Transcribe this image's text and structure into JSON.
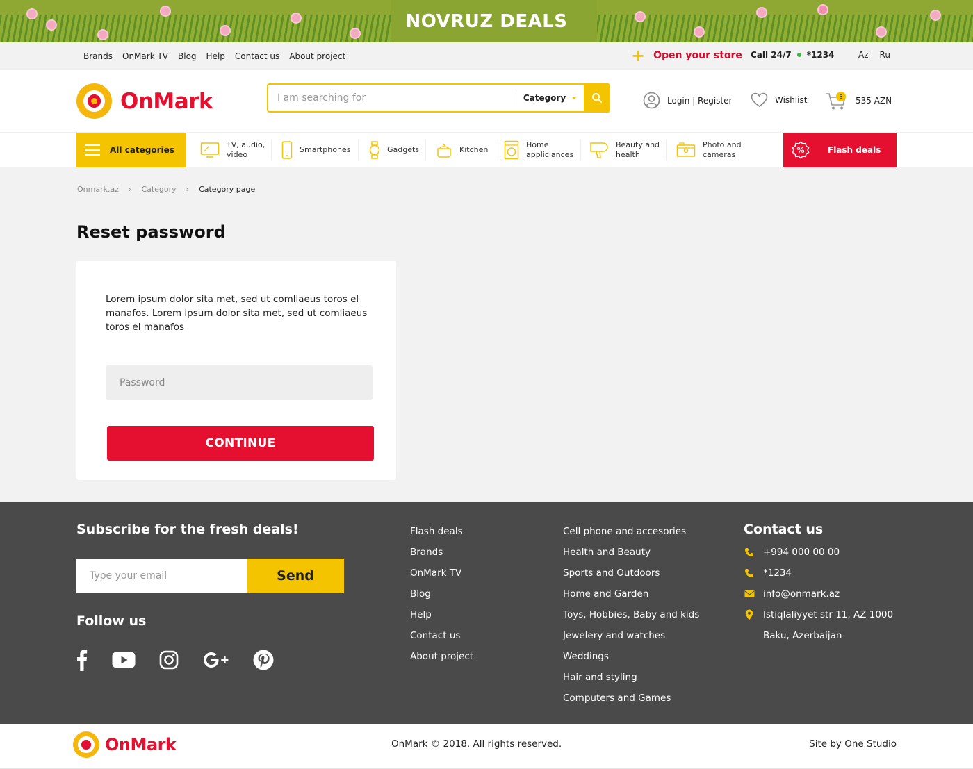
{
  "promo": {
    "label": "NOVRUZ DEALS"
  },
  "topbar": {
    "links": [
      "Brands",
      "OnMark TV",
      "Blog",
      "Help",
      "Contact us",
      "About project"
    ],
    "open_store": "Open your store",
    "call_label": "Call 24/7",
    "call_number": "*1234",
    "langs": [
      "Az",
      "Ru"
    ]
  },
  "header": {
    "logo_text": "OnMark",
    "search_placeholder": "I am searching for",
    "category_label": "Category",
    "login_register": "Login | Register",
    "wishlist": "Wishlist",
    "cart_count": "5",
    "cart_total": "535 AZN"
  },
  "catnav": {
    "all_categories": "All categories",
    "items": [
      {
        "label_1": "TV, audio,",
        "label_2": "video",
        "icon": "tv-icon"
      },
      {
        "label_1": "Smartphones",
        "label_2": "",
        "icon": "smartphone-icon"
      },
      {
        "label_1": "Gadgets",
        "label_2": "",
        "icon": "smartwatch-icon"
      },
      {
        "label_1": "Kitchen",
        "label_2": "",
        "icon": "pot-icon"
      },
      {
        "label_1": "Home",
        "label_2": "appliciances",
        "icon": "washing-machine-icon"
      },
      {
        "label_1": "Beauty and",
        "label_2": "health",
        "icon": "hair-dryer-icon"
      },
      {
        "label_1": "Photo and",
        "label_2": "cameras",
        "icon": "camera-icon"
      }
    ],
    "flash_deals": "Flash deals"
  },
  "breadcrumb": [
    "Onmark.az",
    "Category",
    "Category page"
  ],
  "main": {
    "title": "Reset password",
    "description": "Lorem ipsum dolor sita met, sed ut comliaeus toros el manafos. Lorem ipsum dolor sita met, sed ut comliaeus toros el manafos",
    "password_placeholder": "Password",
    "continue_label": "CONTINUE"
  },
  "footer": {
    "subscribe_title": "Subscribe for the fresh deals!",
    "email_placeholder": "Type your email",
    "send_label": "Send",
    "follow_title": "Follow us",
    "socials": [
      "facebook-icon",
      "youtube-icon",
      "instagram-icon",
      "google-plus-icon",
      "pinterest-icon"
    ],
    "col1": [
      "Flash deals",
      "Brands",
      "OnMark TV",
      "Blog",
      "Help",
      "Contact us",
      "About project"
    ],
    "col2": [
      "Cell phone and accesories",
      "Health and Beauty",
      "Sports and Outdoors",
      "Home and Garden",
      "Toys, Hobbies, Baby and kids",
      "Jewelery and watches",
      "Weddings",
      "Hair and styling",
      "Computers and Games"
    ],
    "contact_title": "Contact us",
    "phone": "+994 000 00 00",
    "short_number": "*1234",
    "email": "info@onmark.az",
    "address_1": "Istiqlaliyyet str 11, AZ 1000",
    "address_2": "Baku, Azerbaijan",
    "logo_text": "OnMark",
    "copyright": "OnMark © 2018. All rights reserved.",
    "credit": "Site by One Studio"
  },
  "colors": {
    "brand_red": "#e5102f",
    "brand_yellow": "#f5c400",
    "footer_bg": "#4a4a4a"
  }
}
